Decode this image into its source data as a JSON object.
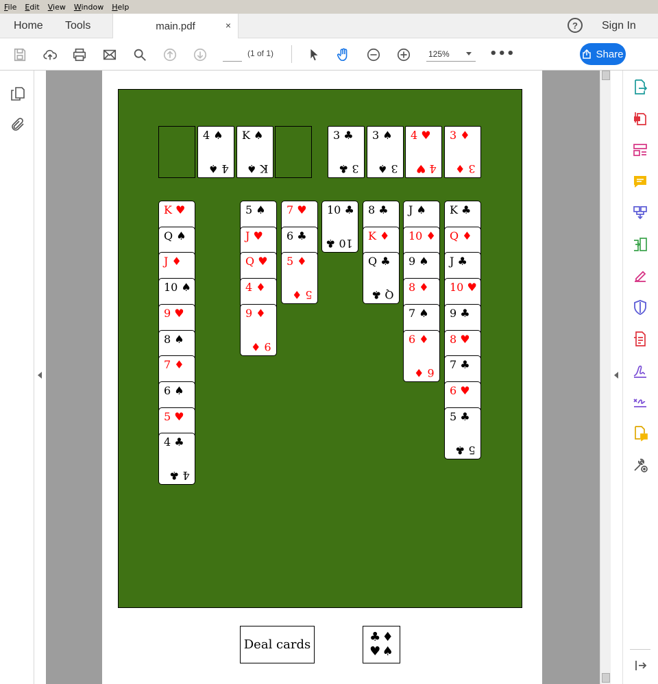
{
  "menu": [
    "File",
    "Edit",
    "View",
    "Window",
    "Help"
  ],
  "tabs": {
    "home": "Home",
    "tools": "Tools",
    "document": "main.pdf",
    "close": "×"
  },
  "header": {
    "help": "?",
    "signin": "Sign In"
  },
  "toolbar": {
    "page_value": "",
    "page_count": "(1 of 1)",
    "zoom": "125%",
    "more": "•••",
    "share": "Share"
  },
  "game": {
    "felt_color": "#3f7214",
    "top_row": [
      {
        "type": "slot"
      },
      {
        "type": "card",
        "rank": "4",
        "suit": "♠",
        "color": "black"
      },
      {
        "type": "card",
        "rank": "K",
        "suit": "♠",
        "color": "black"
      },
      {
        "type": "slot"
      },
      {
        "type": "card",
        "rank": "3",
        "suit": "♣",
        "color": "black"
      },
      {
        "type": "card",
        "rank": "3",
        "suit": "♠",
        "color": "black"
      },
      {
        "type": "card",
        "rank": "4",
        "suit": "♥",
        "color": "red"
      },
      {
        "type": "card",
        "rank": "3",
        "suit": "♦",
        "color": "red"
      }
    ],
    "columns": [
      [
        {
          "rank": "K",
          "suit": "♥",
          "color": "red"
        },
        {
          "rank": "Q",
          "suit": "♠",
          "color": "black"
        },
        {
          "rank": "J",
          "suit": "♦",
          "color": "red"
        },
        {
          "rank": "10",
          "suit": "♠",
          "color": "black"
        },
        {
          "rank": "9",
          "suit": "♥",
          "color": "red"
        },
        {
          "rank": "8",
          "suit": "♠",
          "color": "black"
        },
        {
          "rank": "7",
          "suit": "♦",
          "color": "red"
        },
        {
          "rank": "6",
          "suit": "♠",
          "color": "black"
        },
        {
          "rank": "5",
          "suit": "♥",
          "color": "red"
        },
        {
          "rank": "4",
          "suit": "♣",
          "color": "black"
        }
      ],
      [],
      [
        {
          "rank": "5",
          "suit": "♠",
          "color": "black"
        },
        {
          "rank": "J",
          "suit": "♥",
          "color": "red"
        },
        {
          "rank": "Q",
          "suit": "♥",
          "color": "red"
        },
        {
          "rank": "4",
          "suit": "♦",
          "color": "red"
        },
        {
          "rank": "9",
          "suit": "♦",
          "color": "red"
        }
      ],
      [
        {
          "rank": "7",
          "suit": "♥",
          "color": "red"
        },
        {
          "rank": "6",
          "suit": "♣",
          "color": "black"
        },
        {
          "rank": "5",
          "suit": "♦",
          "color": "red"
        }
      ],
      [
        {
          "rank": "10",
          "suit": "♣",
          "color": "black"
        }
      ],
      [
        {
          "rank": "8",
          "suit": "♣",
          "color": "black"
        },
        {
          "rank": "K",
          "suit": "♦",
          "color": "red"
        },
        {
          "rank": "Q",
          "suit": "♣",
          "color": "black"
        }
      ],
      [
        {
          "rank": "J",
          "suit": "♠",
          "color": "black"
        },
        {
          "rank": "10",
          "suit": "♦",
          "color": "red"
        },
        {
          "rank": "9",
          "suit": "♠",
          "color": "black"
        },
        {
          "rank": "8",
          "suit": "♦",
          "color": "red"
        },
        {
          "rank": "7",
          "suit": "♠",
          "color": "black"
        },
        {
          "rank": "6",
          "suit": "♦",
          "color": "red"
        }
      ],
      [
        {
          "rank": "K",
          "suit": "♣",
          "color": "black"
        },
        {
          "rank": "Q",
          "suit": "♦",
          "color": "red"
        },
        {
          "rank": "J",
          "suit": "♣",
          "color": "black"
        },
        {
          "rank": "10",
          "suit": "♥",
          "color": "red"
        },
        {
          "rank": "9",
          "suit": "♣",
          "color": "black"
        },
        {
          "rank": "8",
          "suit": "♥",
          "color": "red"
        },
        {
          "rank": "7",
          "suit": "♣",
          "color": "black"
        },
        {
          "rank": "6",
          "suit": "♥",
          "color": "red"
        },
        {
          "rank": "5",
          "suit": "♣",
          "color": "black"
        }
      ]
    ],
    "deal_button": "Deal cards",
    "suits_button": [
      "♣",
      "♦",
      "♥",
      "♠"
    ]
  },
  "colors": {
    "share_blue": "#1473e6",
    "card_red": "#ff0000"
  }
}
